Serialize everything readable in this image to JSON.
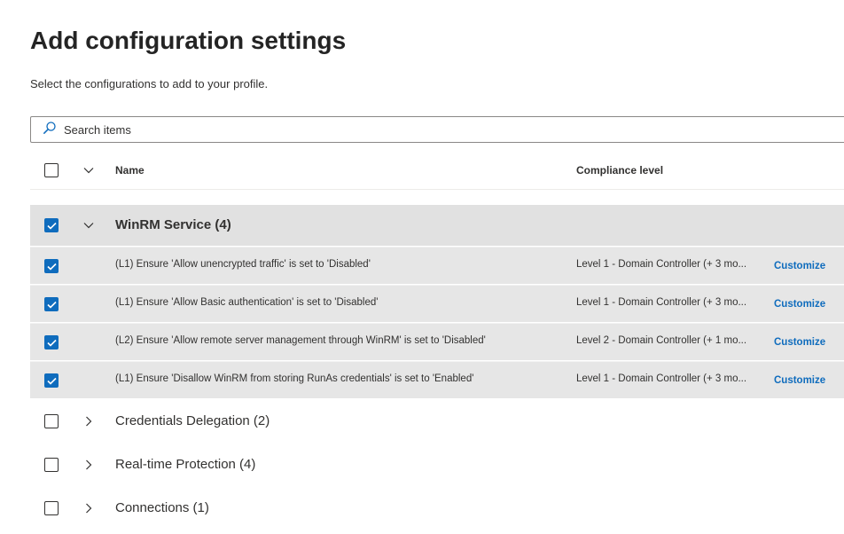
{
  "page": {
    "title": "Add configuration settings",
    "subtitle": "Select the configurations to add to your profile."
  },
  "search": {
    "placeholder": "Search items"
  },
  "table": {
    "headers": {
      "name": "Name",
      "compliance": "Compliance level"
    }
  },
  "groups": [
    {
      "label": "WinRM Service (4)",
      "checked": true,
      "expanded": true,
      "items": [
        {
          "name": "(L1) Ensure 'Allow unencrypted traffic' is set to 'Disabled'",
          "compliance": "Level 1 - Domain Controller (+ 3 mo...",
          "action": "Customize",
          "checked": true
        },
        {
          "name": "(L1) Ensure 'Allow Basic authentication' is set to 'Disabled'",
          "compliance": "Level 1 - Domain Controller (+ 3 mo...",
          "action": "Customize",
          "checked": true
        },
        {
          "name": "(L2) Ensure 'Allow remote server management through WinRM' is set to 'Disabled'",
          "compliance": "Level 2 - Domain Controller (+ 1 mo...",
          "action": "Customize",
          "checked": true
        },
        {
          "name": "(L1) Ensure 'Disallow WinRM from storing RunAs credentials' is set to 'Enabled'",
          "compliance": "Level 1 - Domain Controller (+ 3 mo...",
          "action": "Customize",
          "checked": true
        }
      ]
    },
    {
      "label": "Credentials Delegation (2)",
      "checked": false,
      "expanded": false
    },
    {
      "label": "Real-time Protection (4)",
      "checked": false,
      "expanded": false
    },
    {
      "label": "Connections (1)",
      "checked": false,
      "expanded": false
    }
  ],
  "colors": {
    "accent": "#0f6cbd",
    "selected_row": "#e6e6e6",
    "group_header": "#e1e1e1"
  }
}
